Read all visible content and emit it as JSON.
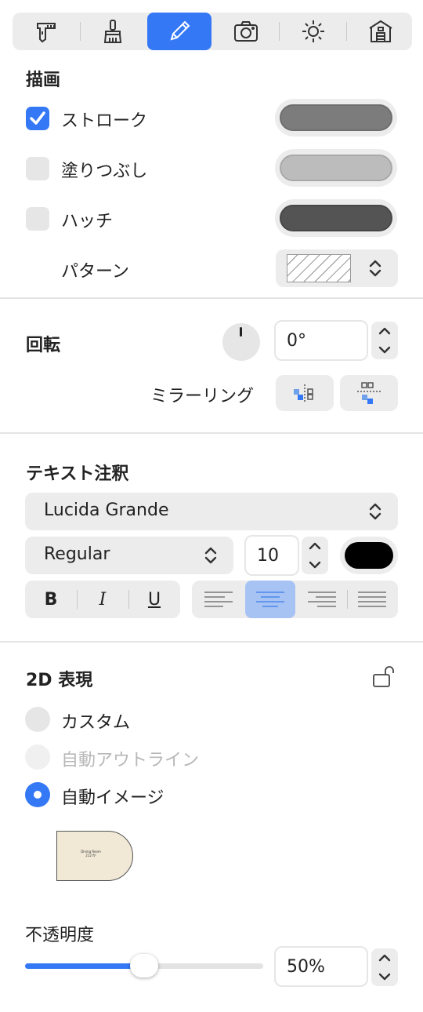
{
  "drawing": {
    "title": "描画",
    "stroke": {
      "label": "ストローク",
      "checked": true,
      "color": "#7c7c7c"
    },
    "fill": {
      "label": "塗りつぶし",
      "checked": false,
      "color": "#bcbcbc"
    },
    "hatch": {
      "label": "ハッチ",
      "checked": false,
      "color": "#545454"
    },
    "pattern": {
      "label": "パターン"
    }
  },
  "rotation": {
    "title": "回転",
    "value": "0°",
    "mirroring_label": "ミラーリング"
  },
  "text_annotation": {
    "title": "テキスト注釈",
    "font": "Lucida Grande",
    "style": "Regular",
    "size": "10",
    "color": "#000000",
    "bold": "B",
    "italic": "I",
    "underline": "U"
  },
  "representation_2d": {
    "title": "2D 表現",
    "options": [
      {
        "label": "カスタム",
        "selected": false,
        "enabled": true
      },
      {
        "label": "自動アウトライン",
        "selected": false,
        "enabled": false
      },
      {
        "label": "自動イメージ",
        "selected": true,
        "enabled": true
      }
    ],
    "preview_label": "Dining Room",
    "preview_sub": "212 ft²"
  },
  "opacity": {
    "label": "不透明度",
    "value": "50%",
    "fraction": 0.5
  },
  "colors": {
    "accent": "#3478f6"
  }
}
